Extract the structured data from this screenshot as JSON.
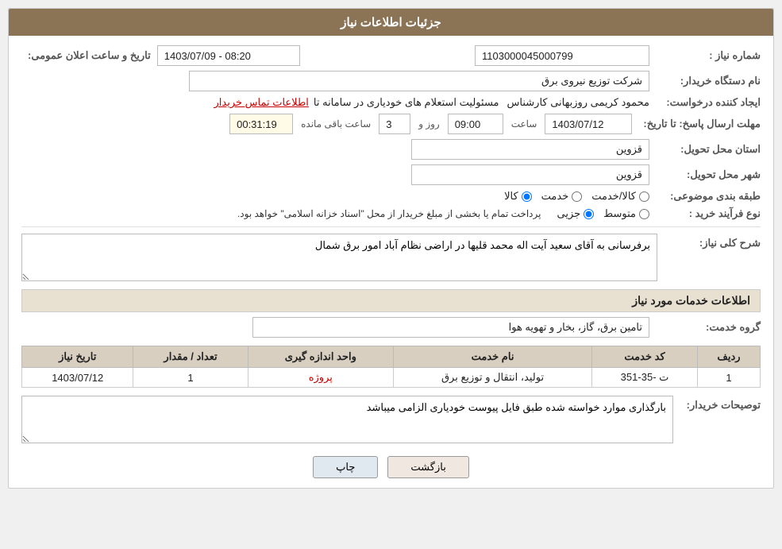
{
  "header": {
    "title": "جزئیات اطلاعات نیاز"
  },
  "fields": {
    "need_number_label": "شماره نیاز :",
    "need_number_value": "1103000045000799",
    "requester_org_label": "نام دستگاه خریدار:",
    "requester_org_value": "شرکت توزیع نیروی برق",
    "creator_label": "ایجاد کننده درخواست:",
    "creator_name": "محمود کریمی روزبهانی کارشناس",
    "creator_role": "مسئولیت استعلام های خودیاری در سامانه تا",
    "creator_link": "اطلاعات تماس خریدار",
    "deadline_label": "مهلت ارسال پاسخ: تا تاریخ:",
    "deadline_date": "1403/07/12",
    "deadline_time_label": "ساعت",
    "deadline_time": "09:00",
    "deadline_days_label": "روز و",
    "deadline_days": "3",
    "deadline_remaining_label": "ساعت باقی مانده",
    "deadline_remaining": "00:31:19",
    "province_label": "استان محل تحویل:",
    "province_value": "قزوین",
    "city_label": "شهر محل تحویل:",
    "city_value": "قزوین",
    "category_label": "طبقه بندی موضوعی:",
    "category_radio1": "کالا",
    "category_radio2": "خدمت",
    "category_radio3": "کالا/خدمت",
    "category_selected": "کالا",
    "purchase_type_label": "نوع فرآیند خرید :",
    "purchase_type_radio1": "جزیی",
    "purchase_type_radio2": "متوسط",
    "purchase_type_note": "پرداخت تمام یا بخشی از مبلغ خریدار از محل \"اسناد خزانه اسلامی\" خواهد بود.",
    "announce_date_label": "تاریخ و ساعت اعلان عمومی:",
    "announce_date_value": "1403/07/09 - 08:20",
    "general_desc_label": "شرح کلی نیاز:",
    "general_desc_value": "برفرسانی به آقای سعید آیت اله محمد قلیها در اراضی نظام آباد امور برق شمال",
    "services_header": "اطلاعات خدمات مورد نیاز",
    "service_group_label": "گروه خدمت:",
    "service_group_value": "تامین برق، گاز، بخار و تهویه هوا",
    "table": {
      "columns": [
        "ردیف",
        "کد خدمت",
        "نام خدمت",
        "واحد اندازه گیری",
        "تعداد / مقدار",
        "تاریخ نیاز"
      ],
      "rows": [
        {
          "row_num": "1",
          "service_code": "ت -35-351",
          "service_name": "تولید، انتقال و توزیع برق",
          "unit": "پروژه",
          "quantity": "1",
          "date": "1403/07/12"
        }
      ]
    },
    "buyer_notes_label": "توصیحات خریدار:",
    "buyer_notes_value": "بارگذاری موارد خواسته شده طبق فایل پیوست خودیاری الزامی میباشد"
  },
  "buttons": {
    "print": "چاپ",
    "back": "بازگشت"
  }
}
